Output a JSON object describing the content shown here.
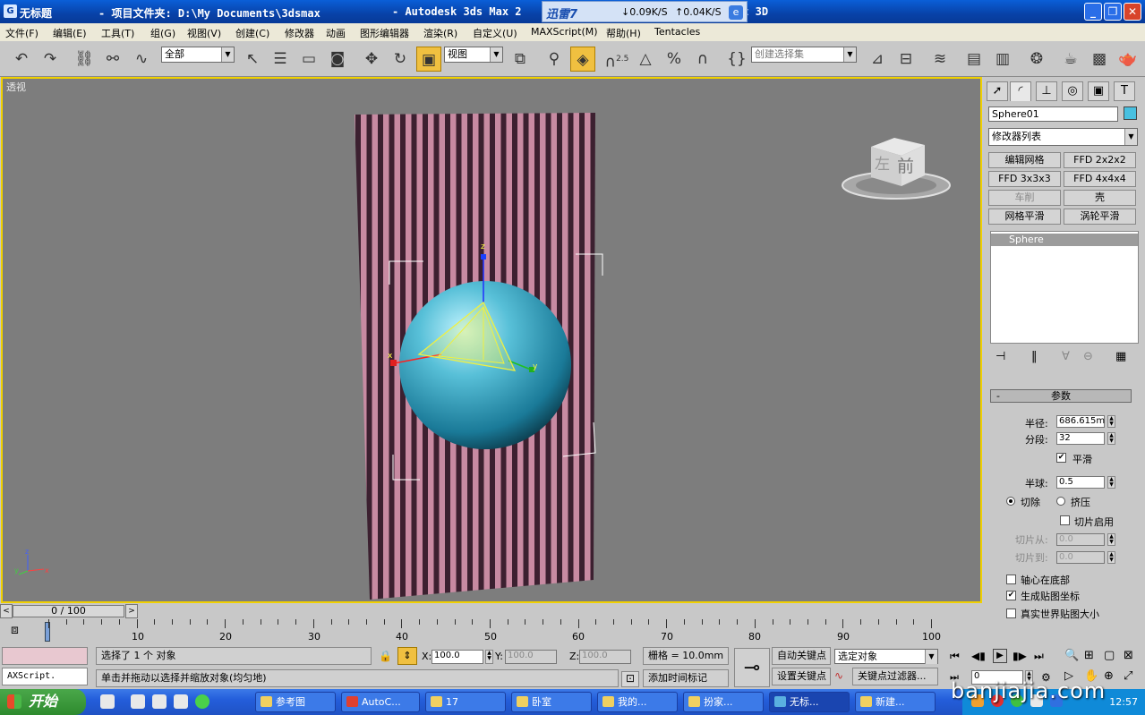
{
  "window": {
    "title": "无标题",
    "project": "- 项目文件夹: D:\\My Documents\\3dsmax",
    "app": "- Autodesk 3ds Max  2",
    "app_tail": "ct 3D",
    "min": "_",
    "max": "❐",
    "close": "✕"
  },
  "xunlei": {
    "logo": "迅雷7",
    "down": "↓0.09K/S",
    "up": "↑0.04K/S"
  },
  "menu": [
    "文件(F)",
    "编辑(E)",
    "工具(T)",
    "组(G)",
    "视图(V)",
    "创建(C)",
    "修改器",
    "动画",
    "图形编辑器",
    "渲染(R)",
    "自定义(U)",
    "MAXScript(M)",
    "帮助(H)",
    "Tentacles"
  ],
  "toolbar": {
    "filter": "全部",
    "refcoord": "视图",
    "selset": "创建选择集",
    "snap_label": "2.5"
  },
  "viewport": {
    "label": "透视",
    "viewcube_left": "左",
    "viewcube_front": "前",
    "gizmo_x": "x",
    "gizmo_y": "y",
    "gizmo_z": "z",
    "axis_x": "x",
    "axis_y": "y",
    "axis_z": "z"
  },
  "cmd": {
    "object_name": "Sphere01",
    "modifier_list": "修改器列表",
    "mod_buttons": [
      "编辑网格",
      "FFD 2x2x2",
      "FFD 3x3x3",
      "FFD 4x4x4",
      "车削",
      "壳",
      "网格平滑",
      "涡轮平滑"
    ],
    "stack_item": "Sphere",
    "params": {
      "title": "参数",
      "radius_label": "半径:",
      "radius": "686.615m",
      "segments_label": "分段:",
      "segments": "32",
      "smooth": "平滑",
      "hemi_label": "半球:",
      "hemi": "0.5",
      "chop": "切除",
      "squash": "挤压",
      "slice_on": "切片启用",
      "slice_from_label": "切片从:",
      "slice_from": "0.0",
      "slice_to_label": "切片到:",
      "slice_to": "0.0",
      "base_pivot": "轴心在底部",
      "gen_map": "生成贴图坐标",
      "real_world": "真实世界贴图大小"
    }
  },
  "timeline": {
    "position": "0 / 100",
    "ticks": [
      "0",
      "10",
      "20",
      "30",
      "40",
      "50",
      "60",
      "70",
      "80",
      "90",
      "100"
    ]
  },
  "status": {
    "selected": "选择了 1 个 对象",
    "prompt": "单击并拖动以选择并缩放对象(均匀地)",
    "x_label": "X:",
    "x": "100.0",
    "y_label": "Y:",
    "y": "100.0",
    "z_label": "Z:",
    "z": "100.0",
    "grid": "栅格 = 10.0mm",
    "add_time_tag": "添加时间标记",
    "auto_key": "自动关键点",
    "set_key": "设置关键点",
    "key_target": "选定对象",
    "key_filters": "关键点过滤器...",
    "frame": "0",
    "maxscript": "AXScript."
  },
  "taskbar": {
    "start": "开始",
    "tasks": [
      "参考图",
      "AutoC...",
      "17",
      "卧室",
      "我的...",
      "扮家...",
      "无标...",
      "新建..."
    ],
    "clock": "12:57"
  },
  "watermark": "banjiajia.com"
}
